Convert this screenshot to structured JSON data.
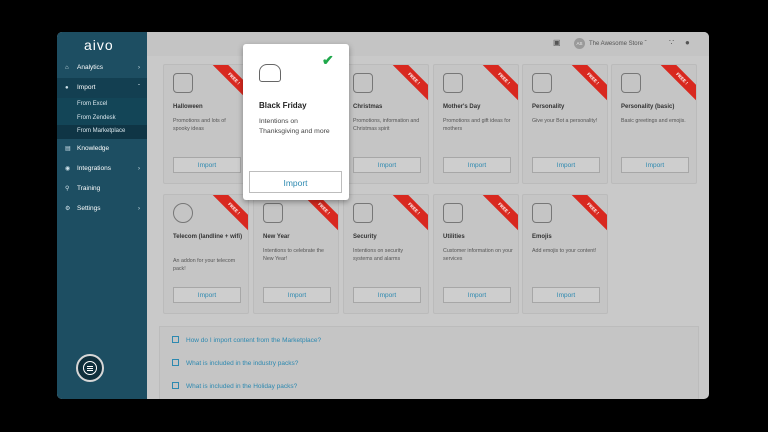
{
  "app": {
    "logo": "aivo"
  },
  "sidebar": {
    "items": [
      {
        "label": "Analytics",
        "icon": "home-icon"
      },
      {
        "label": "Import",
        "icon": "user-icon"
      },
      {
        "label": "Knowledge",
        "icon": "book-icon"
      },
      {
        "label": "Integrations",
        "icon": "chat-icon"
      },
      {
        "label": "Training",
        "icon": "pin-icon"
      },
      {
        "label": "Settings",
        "icon": "gear-icon"
      }
    ],
    "subitems": [
      "From Excel",
      "From Zendesk",
      "From Marketplace"
    ]
  },
  "topbar": {
    "store": "The Awesome Store",
    "avatar": "AS"
  },
  "cards": [
    {
      "title": "Halloween",
      "desc": "Promotions and lots of spooky ideas",
      "button": "Import",
      "badge": "FREE !",
      "icon": "pumpkin-icon"
    },
    {
      "title": "Christmas",
      "desc": "Promotions, information and Christmas spirit",
      "button": "Import",
      "badge": "FREE !",
      "icon": "tree-icon"
    },
    {
      "title": "Mother's Day",
      "desc": "Promotions and gift ideas for mothers",
      "button": "Import",
      "badge": "FREE !",
      "icon": "gift-icon"
    },
    {
      "title": "Personality",
      "desc": "Give your Bot a personality!",
      "button": "Import",
      "badge": "FREE !",
      "icon": "mask-icon"
    },
    {
      "title": "Personality (basic)",
      "desc": "Basic greetings and emojis.",
      "button": "Import",
      "badge": "FREE !",
      "icon": "smile-icon"
    },
    {
      "title": "Telecom (landline + wifi)",
      "desc": "An addon for your telecom pack!",
      "button": "Import",
      "badge": "FREE !",
      "icon": "globe-icon"
    },
    {
      "title": "New Year",
      "desc": "Intentions to celebrate the New Year!",
      "button": "Import",
      "badge": "FREE !",
      "icon": "envelope-icon"
    },
    {
      "title": "Security",
      "desc": "Intentions on security systems and alarms",
      "button": "Import",
      "badge": "FREE !",
      "icon": "lock-icon"
    },
    {
      "title": "Utilities",
      "desc": "Customer information on your services",
      "button": "Import",
      "badge": "FREE !",
      "icon": "house-icon"
    },
    {
      "title": "Emojis",
      "desc": "Add emojis to your content!",
      "button": "Import",
      "badge": "FREE !",
      "icon": "emoji-icon"
    }
  ],
  "popup": {
    "title": "Black Friday",
    "desc": "Intentions on Thanksgiving and more",
    "button": "Import",
    "icon": "turkey-icon",
    "status": "check-icon"
  },
  "faq": [
    "How do I import content from the Marketplace?",
    "What is included in the industry packs?",
    "What is included in the Holiday packs?"
  ],
  "colors": {
    "sidebar": "#1d4e62",
    "accent": "#2d89b0",
    "badge": "#d8281f",
    "check": "#1fa84b"
  }
}
